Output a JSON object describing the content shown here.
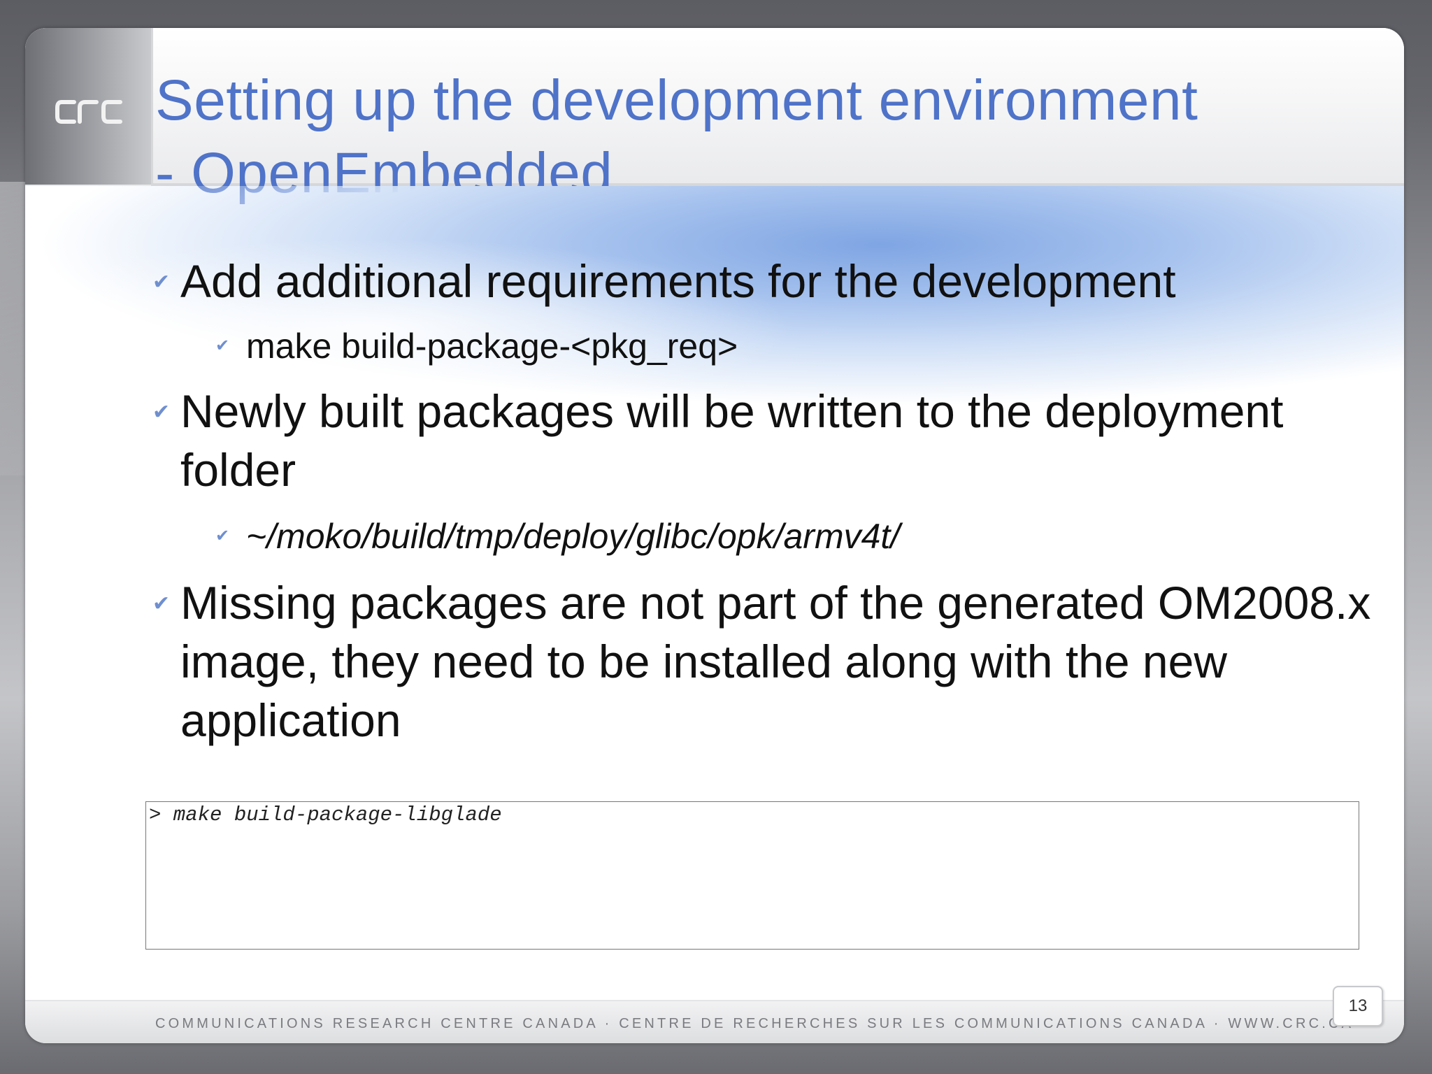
{
  "slide": {
    "title_line1": "Setting up the development environment",
    "title_line2": "- OpenEmbedded",
    "logo_text": "CRC",
    "bullets": [
      {
        "level": 1,
        "text": "Add additional requirements for the development"
      },
      {
        "level": 2,
        "text": "make build-package-<pkg_req>"
      },
      {
        "level": 1,
        "text": "Newly built packages will be written to the deployment folder"
      },
      {
        "level": 2,
        "text": "~/moko/build/tmp/deploy/glibc/opk/armv4t/",
        "italic": true
      },
      {
        "level": 1,
        "text": "Missing packages are not part of the generated OM2008.x image, they need to be installed along with the new application"
      }
    ],
    "code": "> make build-package-libglade",
    "footer": "COMMUNICATIONS RESEARCH CENTRE CANADA  ·  CENTRE DE RECHERCHES SUR LES COMMUNICATIONS CANADA ·  WWW.CRC.CA",
    "page_number": "13"
  },
  "icons": {
    "bullet": "checkmark-icon",
    "logo": "crc-logo"
  },
  "colors": {
    "title": "#4f73c8",
    "bullet": "#6f8fcf",
    "text": "#111111",
    "background_frame": "#5c5d63"
  }
}
